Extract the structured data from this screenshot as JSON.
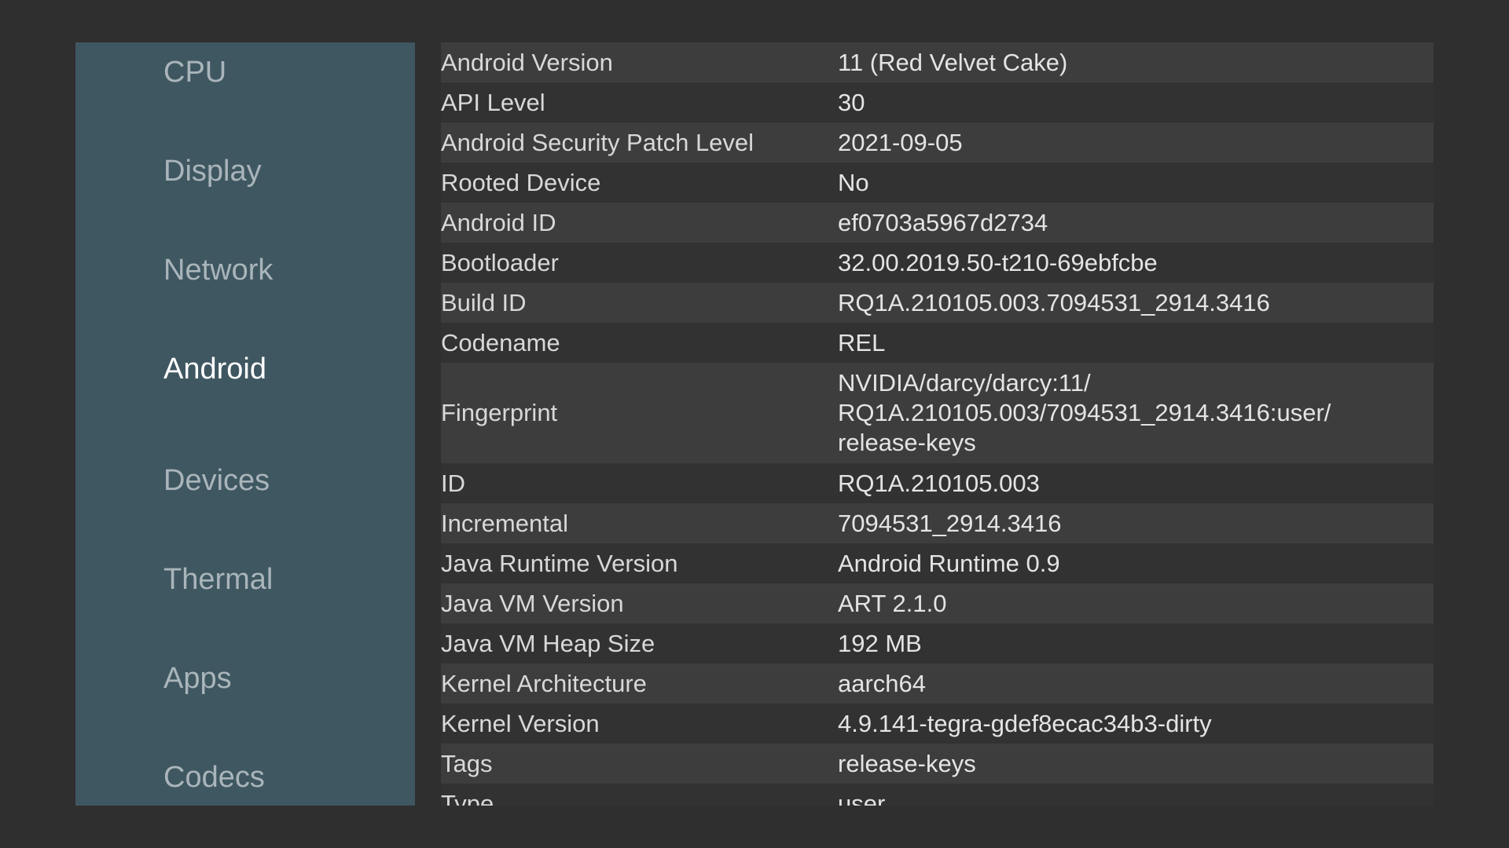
{
  "sidebar": {
    "items": [
      {
        "label": "CPU",
        "active": false
      },
      {
        "label": "Display",
        "active": false
      },
      {
        "label": "Network",
        "active": false
      },
      {
        "label": "Android",
        "active": true
      },
      {
        "label": "Devices",
        "active": false
      },
      {
        "label": "Thermal",
        "active": false
      },
      {
        "label": "Apps",
        "active": false
      },
      {
        "label": "Codecs",
        "active": false
      }
    ]
  },
  "info": {
    "rows": [
      {
        "key": "Android Version",
        "value": "11 (Red Velvet Cake)"
      },
      {
        "key": "API Level",
        "value": "30"
      },
      {
        "key": "Android Security Patch Level",
        "value": "2021-09-05"
      },
      {
        "key": "Rooted Device",
        "value": "No"
      },
      {
        "key": "Android ID",
        "value": "ef0703a5967d2734"
      },
      {
        "key": "Bootloader",
        "value": "32.00.2019.50-t210-69ebfcbe"
      },
      {
        "key": "Build ID",
        "value": "RQ1A.210105.003.7094531_2914.3416"
      },
      {
        "key": "Codename",
        "value": "REL"
      },
      {
        "key": "Fingerprint",
        "value": "NVIDIA/darcy/darcy:11/\nRQ1A.210105.003/7094531_2914.3416:user/\nrelease-keys"
      },
      {
        "key": "ID",
        "value": "RQ1A.210105.003"
      },
      {
        "key": "Incremental",
        "value": "7094531_2914.3416"
      },
      {
        "key": "Java Runtime Version",
        "value": "Android Runtime 0.9"
      },
      {
        "key": "Java VM Version",
        "value": "ART 2.1.0"
      },
      {
        "key": "Java VM Heap Size",
        "value": "192 MB"
      },
      {
        "key": "Kernel Architecture",
        "value": "aarch64"
      },
      {
        "key": "Kernel Version",
        "value": "4.9.141-tegra-gdef8ecac34b3-dirty"
      },
      {
        "key": "Tags",
        "value": "release-keys"
      },
      {
        "key": "Type",
        "value": "user"
      }
    ]
  }
}
